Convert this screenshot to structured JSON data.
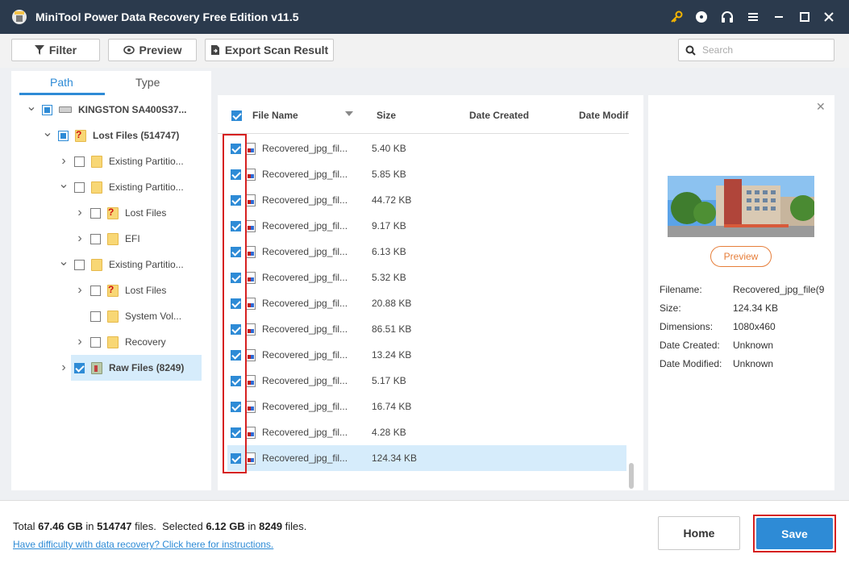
{
  "window": {
    "title": "MiniTool Power Data Recovery Free Edition v11.5"
  },
  "toolbar": {
    "filter_label": "Filter",
    "preview_label": "Preview",
    "export_label": "Export Scan Result",
    "search_placeholder": "Search"
  },
  "left_tabs": {
    "path": "Path",
    "type": "Type",
    "active": "Path"
  },
  "tree": [
    {
      "label": "KINGSTON SA400S37...",
      "icon": "drive-icon",
      "check": "partial",
      "expander": "expanded"
    },
    {
      "label": "Lost Files (514747)",
      "icon": "lost-folder-icon",
      "check": "partial",
      "expander": "expanded"
    },
    {
      "label": "Existing Partitio...",
      "icon": "folder-icon",
      "check": "unchecked",
      "expander": "collapsed"
    },
    {
      "label": "Existing Partitio...",
      "icon": "folder-icon",
      "check": "unchecked",
      "expander": "expanded"
    },
    {
      "label": "Lost Files",
      "icon": "lost-folder-icon",
      "check": "unchecked",
      "expander": "collapsed"
    },
    {
      "label": "EFI",
      "icon": "folder-icon",
      "check": "unchecked",
      "expander": "collapsed"
    },
    {
      "label": "Existing Partitio...",
      "icon": "folder-icon",
      "check": "unchecked",
      "expander": "expanded"
    },
    {
      "label": "Lost Files",
      "icon": "lost-folder-icon",
      "check": "unchecked",
      "expander": "collapsed"
    },
    {
      "label": "System Vol...",
      "icon": "folder-icon",
      "check": "unchecked",
      "expander": "none"
    },
    {
      "label": "Recovery",
      "icon": "folder-icon",
      "check": "unchecked",
      "expander": "collapsed"
    },
    {
      "label": "Raw Files (8249)",
      "icon": "raw-folder-icon",
      "check": "checked",
      "expander": "collapsed",
      "selected": true
    }
  ],
  "file_list": {
    "headers": {
      "name": "File Name",
      "size": "Size",
      "created": "Date Created",
      "modified": "Date Modif"
    },
    "rows": [
      {
        "name": "Recovered_jpg_fil...",
        "size": "5.40 KB"
      },
      {
        "name": "Recovered_jpg_fil...",
        "size": "5.85 KB"
      },
      {
        "name": "Recovered_jpg_fil...",
        "size": "44.72 KB"
      },
      {
        "name": "Recovered_jpg_fil...",
        "size": "9.17 KB"
      },
      {
        "name": "Recovered_jpg_fil...",
        "size": "6.13 KB"
      },
      {
        "name": "Recovered_jpg_fil...",
        "size": "5.32 KB"
      },
      {
        "name": "Recovered_jpg_fil...",
        "size": "20.88 KB"
      },
      {
        "name": "Recovered_jpg_fil...",
        "size": "86.51 KB"
      },
      {
        "name": "Recovered_jpg_fil...",
        "size": "13.24 KB"
      },
      {
        "name": "Recovered_jpg_fil...",
        "size": "5.17 KB"
      },
      {
        "name": "Recovered_jpg_fil...",
        "size": "16.74 KB"
      },
      {
        "name": "Recovered_jpg_fil...",
        "size": "4.28 KB"
      },
      {
        "name": "Recovered_jpg_fil...",
        "size": "124.34 KB",
        "selected": true
      }
    ]
  },
  "preview": {
    "button_label": "Preview",
    "filename_label": "Filename:",
    "filename_value": "Recovered_jpg_file(9",
    "size_label": "Size:",
    "size_value": "124.34 KB",
    "dimensions_label": "Dimensions:",
    "dimensions_value": "1080x460",
    "created_label": "Date Created:",
    "created_value": "Unknown",
    "modified_label": "Date Modified:",
    "modified_value": "Unknown"
  },
  "footer": {
    "total_prefix": "Total",
    "total_size": "67.46 GB",
    "in_word": "in",
    "total_files": "514747",
    "files_word": "files.",
    "selected_prefix": "Selected",
    "selected_size": "6.12 GB",
    "selected_files": "8249",
    "help_link": "Have difficulty with data recovery? Click here for instructions.",
    "home_label": "Home",
    "save_label": "Save"
  },
  "colors": {
    "titlebar": "#2b3a4d",
    "accent": "#2e8bd6",
    "highlight_box": "#d62020",
    "preview_button": "#e67e3a"
  }
}
